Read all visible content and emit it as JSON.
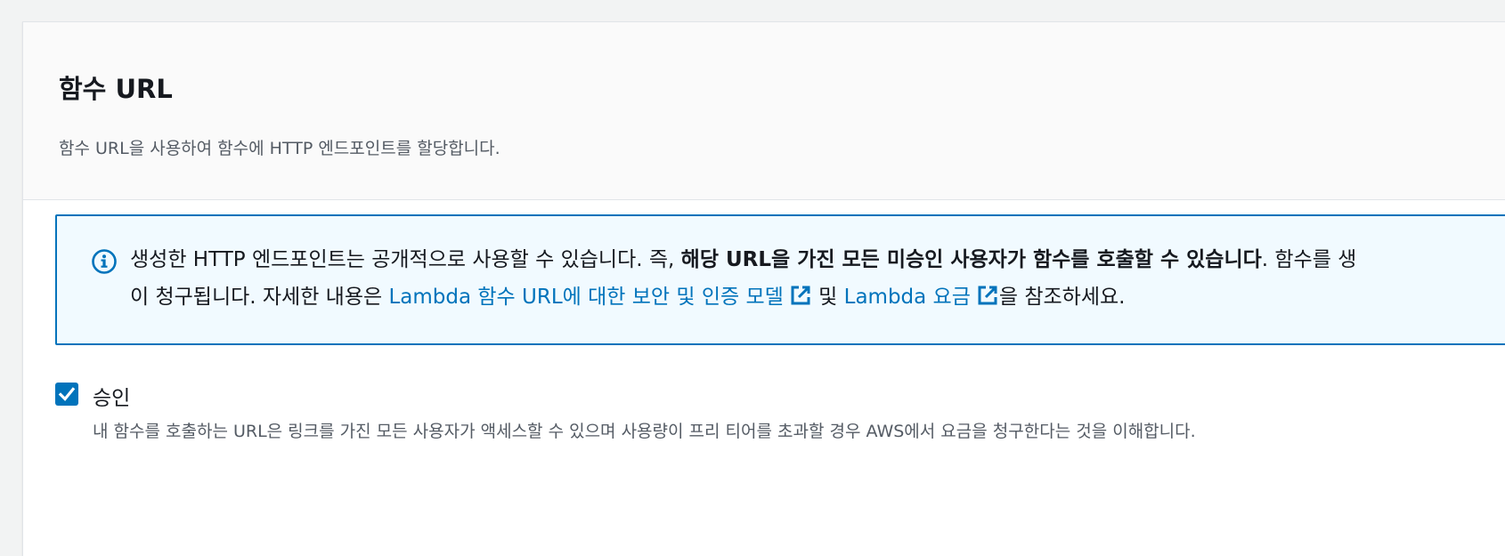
{
  "section": {
    "title": "함수 URL",
    "description": "함수 URL을 사용하여 함수에 HTTP 엔드포인트를 할당합니다."
  },
  "alert": {
    "icon": "info-icon",
    "accent_color": "#0073bb",
    "background_color": "#f1faff",
    "line1_plain": "생성한 HTTP 엔드포인트는 공개적으로 사용할 수 있습니다. 즉, ",
    "line1_bold": "해당 URL을 가진 모든 미승인 사용자가 함수를 호출할 수 있습니다",
    "line1_tail": ". 함수를 생",
    "line2_plain": "이 청구됩니다. 자세한 내용은 ",
    "link1_label": "Lambda 함수 URL에 대한 보안 및 인증 모델",
    "link_between": " 및 ",
    "link2_label": "Lambda 요금",
    "line2_tail": "을 참조하세요.",
    "external_link_icon": "external-link-icon"
  },
  "acknowledge": {
    "checked": true,
    "label": "승인",
    "description": "내 함수를 호출하는 URL은 링크를 가진 모든 사용자가 액세스할 수 있으며 사용량이 프리 티어를 초과할 경우 AWS에서 요금을 청구한다는 것을 이해합니다."
  }
}
